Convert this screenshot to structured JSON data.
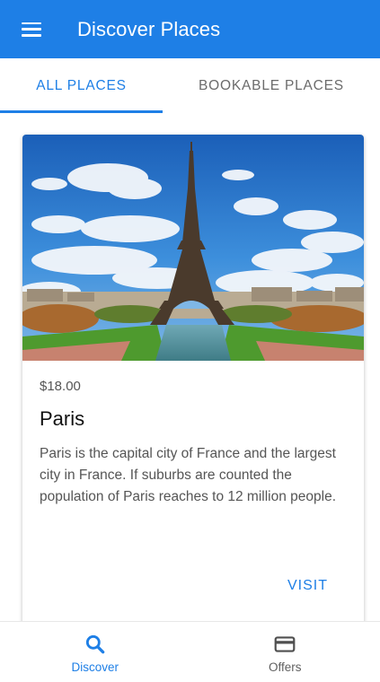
{
  "toolbar": {
    "title": "Discover Places",
    "menu_icon": "menu-icon"
  },
  "tabs": [
    {
      "label": "ALL PLACES",
      "active": true
    },
    {
      "label": "BOOKABLE PLACES",
      "active": false
    }
  ],
  "place": {
    "image": "eiffel-tower-photo",
    "price": "$18.00",
    "title": "Paris",
    "description": "Paris is the capital city of France and the largest city in France. If suburbs are counted the population of Paris reaches to 12 million people.",
    "action_label": "VISIT"
  },
  "bottom_nav": [
    {
      "label": "Discover",
      "icon": "search-icon",
      "active": true
    },
    {
      "label": "Offers",
      "icon": "card-icon",
      "active": false
    }
  ],
  "colors": {
    "primary": "#1e7fe6",
    "inactive": "#5f5f5f"
  }
}
